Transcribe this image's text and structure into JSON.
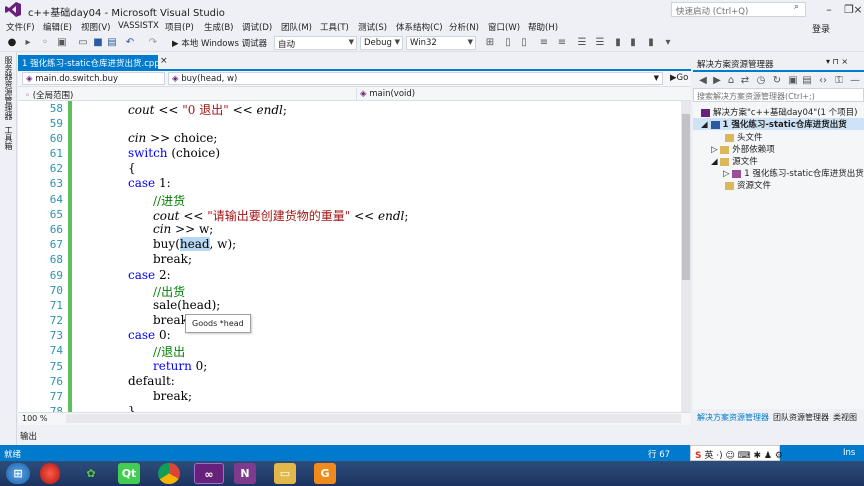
{
  "window": {
    "title": "c++基础day04 - Microsoft Visual Studio",
    "quick_launch_placeholder": "快速启动 (Ctrl+Q)",
    "login": "登录"
  },
  "menu": [
    "文件(F)",
    "编辑(E)",
    "视图(V)",
    "VASSISTX",
    "项目(P)",
    "生成(B)",
    "调试(D)",
    "团队(M)",
    "工具(T)",
    "测试(S)",
    "体系结构(C)",
    "分析(N)",
    "窗口(W)",
    "帮助(H)"
  ],
  "toolbar": {
    "debugger_label": "▶ 本地 Windows 调试器",
    "config_auto": "自动",
    "config": "Debug",
    "platform": "Win32"
  },
  "left_tabs": [
    "服务器资源管理器",
    "工具箱"
  ],
  "document_tab": {
    "label": "1 强化练习-static仓库进货出货.cpp",
    "close": "×"
  },
  "nav": {
    "scope_left": "main.do.switch.buy",
    "scope_right": "buy(head, w)",
    "global": "(全局范围)",
    "function": "main(void)"
  },
  "code_lines": [
    {
      "n": "58"
    },
    {
      "n": "59"
    },
    {
      "n": "60"
    },
    {
      "n": "61"
    },
    {
      "n": "62"
    },
    {
      "n": "63"
    },
    {
      "n": "64"
    },
    {
      "n": "65"
    },
    {
      "n": "66"
    },
    {
      "n": "67"
    },
    {
      "n": "68"
    },
    {
      "n": "69"
    },
    {
      "n": "70"
    },
    {
      "n": "71"
    },
    {
      "n": "72"
    },
    {
      "n": "73"
    },
    {
      "n": "74"
    },
    {
      "n": "75"
    },
    {
      "n": "76"
    },
    {
      "n": "77"
    },
    {
      "n": "78"
    }
  ],
  "code": {
    "l58_a": "cout",
    "l58_b": " << ",
    "l58_c": "\"0 退出\"",
    "l58_d": " << ",
    "l58_e": "endl",
    "l58_f": ";",
    "l60_a": "cin",
    "l60_b": " >> choice;",
    "l61_a": "switch",
    "l61_b": " (choice)",
    "l62": "{",
    "l63_a": "case",
    "l63_b": " 1:",
    "l64": "//进货",
    "l65_a": "cout",
    "l65_b": " << ",
    "l65_c": "\"请输出要创建货物的重量\"",
    "l65_d": " << ",
    "l65_e": "endl",
    "l65_f": ";",
    "l66_a": "cin",
    "l66_b": " >> w;",
    "l67_a": "buy(",
    "l67_b": "head",
    "l67_c": ", w);",
    "l68": "break;",
    "l69_a": "case",
    "l69_b": " 2:",
    "l70": "//出货",
    "l71": "sale(head);",
    "l72": "break",
    "l73_a": "case",
    "l73_b": " 0:",
    "l74": "//退出",
    "l75_a": "return",
    "l75_b": " 0;",
    "l76": "default:",
    "l77": "break;",
    "l78": "}"
  },
  "tooltip": "Goods *head",
  "zoom": "100 %",
  "output_label": "输出",
  "solution_explorer": {
    "title": "解决方案资源管理器",
    "search_placeholder": "搜索解决方案资源管理器(Ctrl+;)",
    "tree": [
      {
        "label": "解决方案\"c++基础day04\"(1 个项目)"
      },
      {
        "label": "1 强化练习-static仓库进货出货"
      },
      {
        "label": "头文件"
      },
      {
        "label": "外部依赖项"
      },
      {
        "label": "源文件"
      },
      {
        "label": "1 强化练习-static仓库进货出货.cpp"
      },
      {
        "label": "资源文件"
      }
    ],
    "tabs": [
      "解决方案资源管理器",
      "团队资源管理器",
      "类视图"
    ]
  },
  "status": {
    "left": "就绪",
    "row": "行 67",
    "ins": "Ins"
  },
  "colors": {
    "accent": "#007acc",
    "keyword": "#0000ff",
    "string": "#a31515",
    "comment": "#008000",
    "line_number": "#2b91af"
  }
}
